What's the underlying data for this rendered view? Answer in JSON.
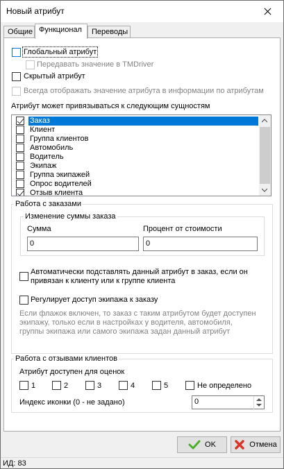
{
  "window": {
    "title": "Новый атрибут"
  },
  "tabs": [
    {
      "label": "Общие"
    },
    {
      "label": "Функционал"
    },
    {
      "label": "Переводы"
    }
  ],
  "options": {
    "global_attribute": "Глобальный атрибут",
    "pass_to_tmdriver": "Передавать значение в TMDriver",
    "hidden_attribute": "Скрытый атрибут",
    "always_show": "Всегда отображать значение атрибута в информации по атрибутам"
  },
  "entities": {
    "heading": "Атрибут может привязываться к следующим сущностям",
    "items": [
      {
        "label": "Заказ",
        "checked": true,
        "selected": true
      },
      {
        "label": "Клиент",
        "checked": false
      },
      {
        "label": "Группа клиентов",
        "checked": false
      },
      {
        "label": "Автомобиль",
        "checked": false
      },
      {
        "label": "Водитель",
        "checked": false
      },
      {
        "label": "Экипаж",
        "checked": false
      },
      {
        "label": "Группа экипажей",
        "checked": false
      },
      {
        "label": "Опрос водителей",
        "checked": false
      },
      {
        "label": "Отзыв клиента",
        "checked": true
      }
    ]
  },
  "orders": {
    "group_title": "Работа с заказами",
    "sum_change_title": "Изменение суммы заказа",
    "sum_label": "Сумма",
    "sum_value": "0",
    "percent_label": "Процент от стоимости",
    "percent_value": "0",
    "auto_substitute": "Автоматически подставлять данный атрибут в заказ, если он привязан к клиенту или к группе клиента",
    "regulates_access": "Регулирует доступ экипажа к заказу",
    "access_help": "Если флажок включен, то заказ с таким атрибутом будет доступен экипажу, только если в настройках у водителя, автомобиля, группы экипажа или самого экипажа задан данный атрибут"
  },
  "reviews": {
    "group_title": "Работа с отзывами клиентов",
    "available_for": "Атрибут доступен для оценок",
    "ratings": [
      "1",
      "2",
      "3",
      "4",
      "5"
    ],
    "undefined_label": "Не определено",
    "icon_index_label": "Индекс иконки (0 - не задано)",
    "icon_index_value": "0"
  },
  "buttons": {
    "ok": "OK",
    "cancel": "Отмена"
  },
  "status": {
    "id_text": "ИД: 83"
  },
  "colors": {
    "selection": "#0078d7",
    "ok_icon": "#4caf2a",
    "cancel_icon": "#d9342b"
  }
}
